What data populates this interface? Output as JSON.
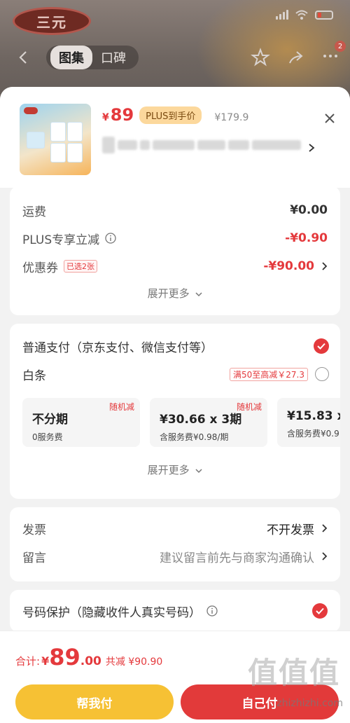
{
  "background": {
    "brand_logo": "三元",
    "tabs": [
      {
        "label": "图集",
        "active": true
      },
      {
        "label": "口碑",
        "active": false
      }
    ],
    "badge_count": "2"
  },
  "product": {
    "price_currency": "¥",
    "price": "89",
    "plus_tag": "PLUS到手价",
    "original_price": "¥179.9"
  },
  "fees": {
    "shipping_label": "运费",
    "shipping_value": "¥0.00",
    "plus_discount_label": "PLUS专享立减",
    "plus_discount_value": "-¥0.90",
    "coupon_label": "优惠券",
    "coupon_tag": "已选2张",
    "coupon_value": "-¥90.00",
    "expand": "展开更多"
  },
  "payment": {
    "normal_label": "普通支付（京东支付、微信支付等）",
    "baitiao_label": "白条",
    "baitiao_promo": "满50至高减￥27.3",
    "plans": [
      {
        "random": "",
        "main": "不分期",
        "sub": "0服务费"
      },
      {
        "random": "随机减",
        "main": "¥30.66 x 3期",
        "sub": "含服务费¥0.98/期"
      },
      {
        "random": "",
        "main": "¥15.83 x",
        "sub": "含服务费¥0.9"
      }
    ],
    "plan0_random": "随机减",
    "expand": "展开更多"
  },
  "invoice": {
    "invoice_label": "发票",
    "invoice_value": "不开发票",
    "message_label": "留言",
    "message_hint": "建议留言前先与商家沟通确认"
  },
  "privacy": {
    "label": "号码保护（隐藏收件人真实号码）"
  },
  "footer": {
    "total_label": "合计:",
    "total_currency": "¥",
    "total_int": "89",
    "total_dec": ".00",
    "total_saved": "共减 ¥90.90",
    "help_pay": "帮我付",
    "self_pay": "自己付",
    "watermark": "zhizhizhi.com",
    "watermark_big": "值值值"
  },
  "colors": {
    "accent": "#e4393c",
    "plus": "#fcd89c",
    "help_button": "#f6c134",
    "self_button": "#e23a3a"
  }
}
